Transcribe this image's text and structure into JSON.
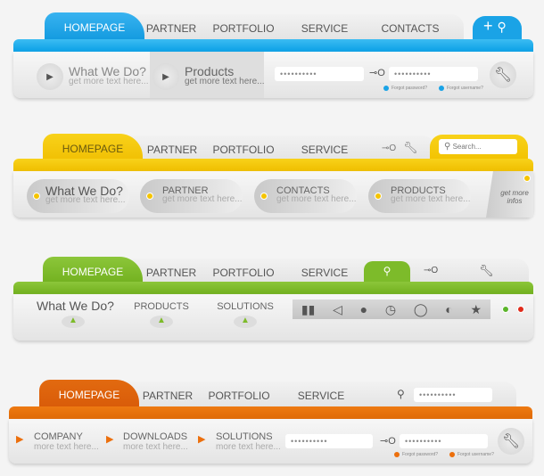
{
  "nav1": {
    "color": "#1aa3e6",
    "tabs": [
      "HOMEPAGE",
      "PARTNER",
      "PORTFOLIO",
      "SERVICE",
      "CONTACTS"
    ],
    "items": [
      {
        "title": "What We Do?",
        "sub": "get more text here..."
      },
      {
        "title": "Products",
        "sub": "get more text here..."
      }
    ],
    "password": "••••••••••",
    "username": "••••••••••",
    "forgot_password": "Forgot password?",
    "forgot_username": "Forgot username?"
  },
  "nav2": {
    "color": "#f5c400",
    "tabs": [
      "HOMEPAGE",
      "PARTNER",
      "PORTFOLIO",
      "SERVICE"
    ],
    "search_placeholder": "Search...",
    "items": [
      {
        "title": "What We Do?",
        "sub": "get more text here..."
      },
      {
        "title": "PARTNER",
        "sub": "get more text here..."
      },
      {
        "title": "CONTACTS",
        "sub": "get more text here..."
      },
      {
        "title": "PRODUCTS",
        "sub": "get more text here..."
      }
    ],
    "more": "get more infos"
  },
  "nav3": {
    "color": "#7dbb2a",
    "tabs": [
      "HOMEPAGE",
      "PARTNER",
      "PORTFOLIO",
      "SERVICE"
    ],
    "items": [
      "What We Do?",
      "PRODUCTS",
      "SOLUTIONS"
    ],
    "icons": [
      "bar-chart-icon",
      "megaphone-icon",
      "pin-icon",
      "clock-icon",
      "speech-bubble-icon",
      "mouse-icon",
      "star-icon"
    ]
  },
  "nav4": {
    "color": "#ec6f0c",
    "tabs": [
      "HOMEPAGE",
      "PARTNER",
      "PORTFOLIO",
      "SERVICE"
    ],
    "search_value": "••••••••••",
    "items": [
      {
        "title": "COMPANY",
        "sub": "more text here..."
      },
      {
        "title": "DOWNLOADS",
        "sub": "more text here..."
      },
      {
        "title": "SOLUTIONS",
        "sub": "more text here..."
      }
    ],
    "password": "••••••••••",
    "username": "••••••••••",
    "forgot_password": "Forgot password?",
    "forgot_username": "Forgot username?"
  }
}
